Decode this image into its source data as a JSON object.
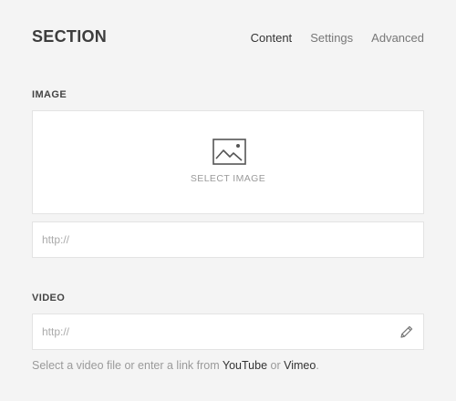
{
  "header": {
    "title": "SECTION",
    "tabs": [
      {
        "label": "Content",
        "active": true
      },
      {
        "label": "Settings",
        "active": false
      },
      {
        "label": "Advanced",
        "active": false
      }
    ]
  },
  "image_field": {
    "label": "IMAGE",
    "select_label": "SELECT IMAGE",
    "url_placeholder": "http://",
    "url_value": ""
  },
  "video_field": {
    "label": "VIDEO",
    "url_placeholder": "http://",
    "url_value": "",
    "edit_icon": "pencil-icon",
    "help_prefix": "Select a video file or enter a link from",
    "help_link_1": "YouTube",
    "help_or": "or",
    "help_link_2": "Vimeo",
    "help_suffix": "."
  },
  "colors": {
    "background": "#f4f4f4",
    "input_background": "#ffffff",
    "border": "#e3e3e3",
    "muted_text": "#9a9a9a",
    "strong_text": "#333333"
  }
}
